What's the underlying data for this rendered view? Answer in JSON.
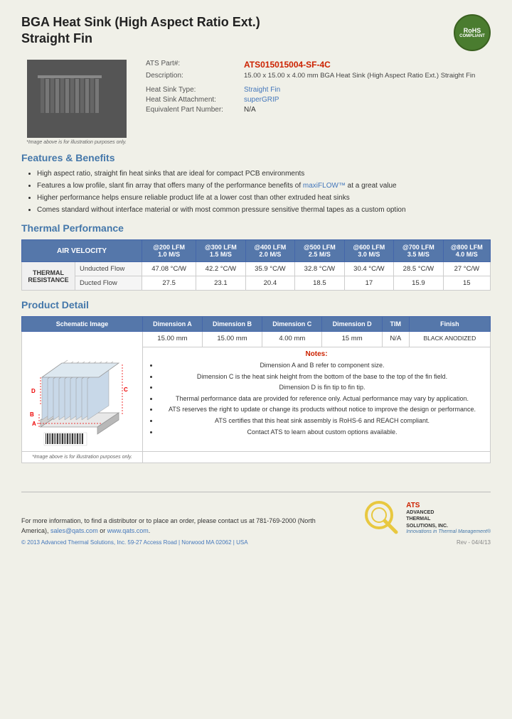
{
  "header": {
    "title_line1": "BGA Heat Sink (High Aspect Ratio Ext.)",
    "title_line2": "Straight Fin",
    "rohs_line1": "RoHS",
    "rohs_line2": "COMPLIANT"
  },
  "product": {
    "part_label": "ATS Part#:",
    "part_number": "ATS015015004-SF-4C",
    "desc_label": "Description:",
    "description": "15.00 x 15.00 x 4.00 mm  BGA Heat Sink (High Aspect Ratio Ext.) Straight Fin",
    "type_label": "Heat Sink Type:",
    "type_value": "Straight Fin",
    "attach_label": "Heat Sink Attachment:",
    "attach_value": "superGRIP",
    "equiv_label": "Equivalent Part Number:",
    "equiv_value": "N/A",
    "image_caption": "*Image above is for illustration purposes only."
  },
  "features": {
    "section_title": "Features & Benefits",
    "items": [
      "High aspect ratio, straight fin heat sinks that are ideal for compact PCB environments",
      "Features a low profile, slant fin array that offers many of the performance benefits of maxiFLOW™ at a great value",
      "Higher performance helps ensure reliable product life at a lower cost than other extruded heat sinks",
      "Comes standard without interface material or with most common pressure sensitive thermal tapes as a custom option"
    ]
  },
  "thermal": {
    "section_title": "Thermal Performance",
    "col_header_air": "AIR VELOCITY",
    "columns": [
      {
        "label": "@200 LFM",
        "sub": "1.0 M/S"
      },
      {
        "label": "@300 LFM",
        "sub": "1.5 M/S"
      },
      {
        "label": "@400 LFM",
        "sub": "2.0 M/S"
      },
      {
        "label": "@500 LFM",
        "sub": "2.5 M/S"
      },
      {
        "label": "@600 LFM",
        "sub": "3.0 M/S"
      },
      {
        "label": "@700 LFM",
        "sub": "3.5 M/S"
      },
      {
        "label": "@800 LFM",
        "sub": "4.0 M/S"
      }
    ],
    "row_label": "THERMAL RESISTANCE",
    "rows": [
      {
        "type": "Unducted Flow",
        "values": [
          "47.08 °C/W",
          "42.2 °C/W",
          "35.9 °C/W",
          "32.8 °C/W",
          "30.4 °C/W",
          "28.5 °C/W",
          "27 °C/W"
        ]
      },
      {
        "type": "Ducted Flow",
        "values": [
          "27.5",
          "23.1",
          "20.4",
          "18.5",
          "17",
          "15.9",
          "15"
        ]
      }
    ]
  },
  "product_detail": {
    "section_title": "Product Detail",
    "table_headers": [
      "Schematic Image",
      "Dimension A",
      "Dimension B",
      "Dimension C",
      "Dimension D",
      "TIM",
      "Finish"
    ],
    "dimension_values": [
      "15.00 mm",
      "15.00 mm",
      "4.00 mm",
      "15 mm",
      "N/A",
      "BLACK ANODIZED"
    ],
    "schematic_caption": "*Image above is for illustration purposes only.",
    "notes_title": "Notes:",
    "notes": [
      "Dimension A and B refer to component size.",
      "Dimension C is the heat sink height from the bottom of the base to the top of the fin field.",
      "Dimension D is fin tip to fin tip.",
      "Thermal performance data are provided for reference only. Actual performance may vary by application.",
      "ATS reserves the right to update or change its products without notice to improve the design or performance.",
      "ATS certifies that this heat sink assembly is RoHS-6 and REACH compliant.",
      "Contact ATS to learn about custom options available."
    ]
  },
  "footer": {
    "contact_text": "For more information, to find a distributor or to place an order, please contact us at 781-769-2000 (North America),",
    "email": "sales@qats.com",
    "or_text": "or",
    "website": "www.qats.com",
    "copyright": "© 2013 Advanced Thermal Solutions, Inc.",
    "address": "59-27 Access Road  |  Norwood MA  02062  |  USA",
    "ats_name": "ATS",
    "ats_full": "ADVANCED\nTHERMAL\nSOLUTIONS, INC.",
    "ats_tagline": "Innovations in Thermal Management®",
    "rev": "Rev - 04/4/13"
  }
}
